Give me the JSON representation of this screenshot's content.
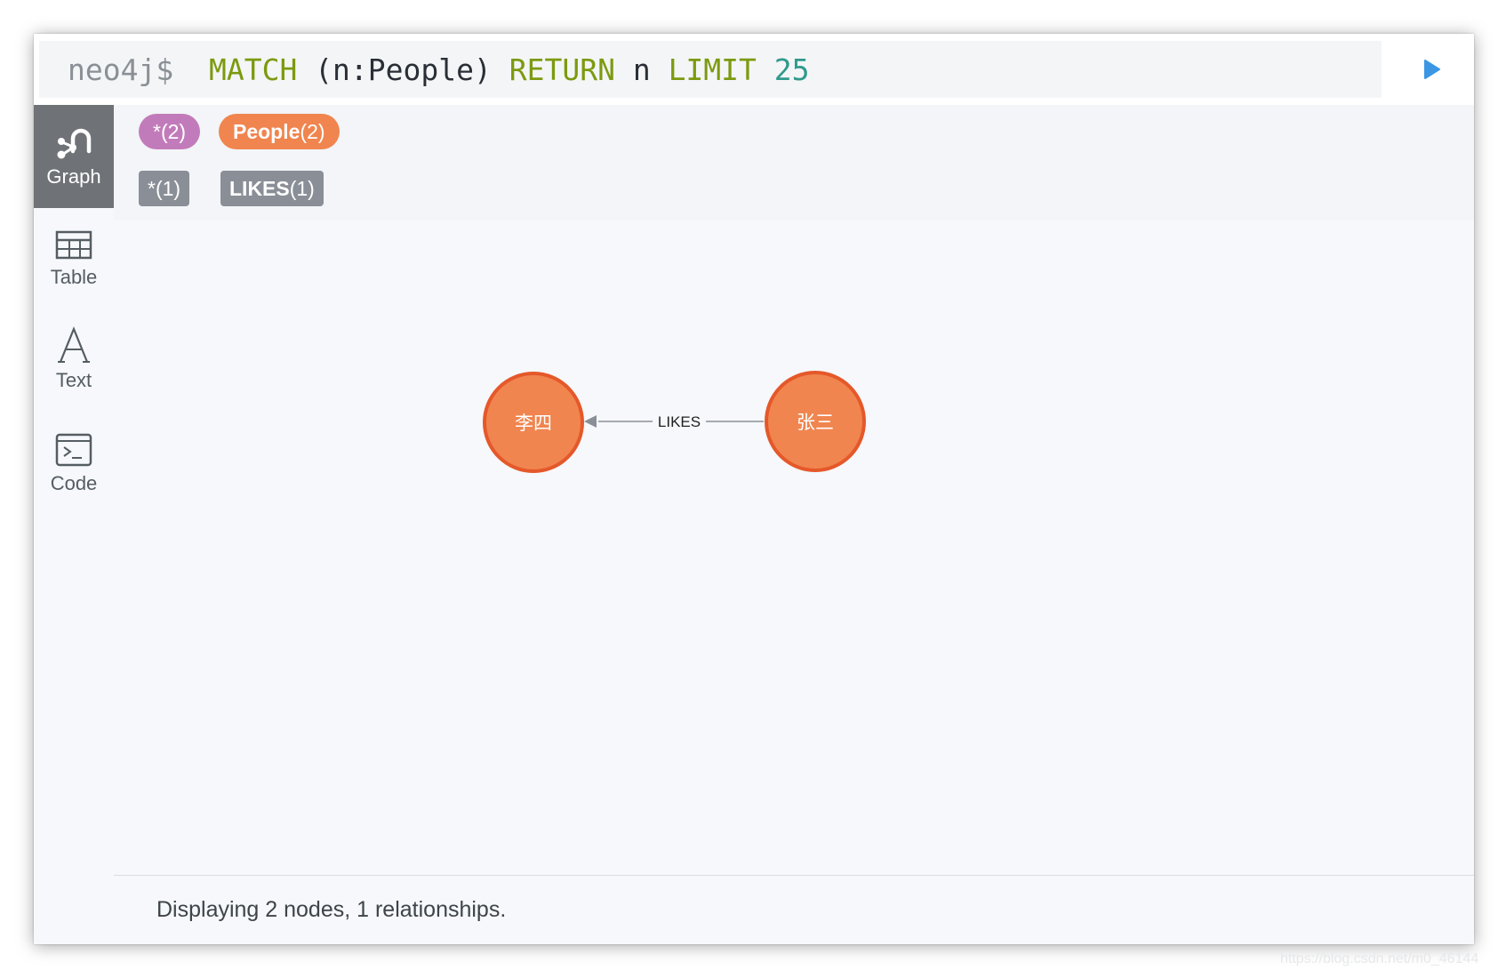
{
  "editor": {
    "prompt": "neo4j$",
    "tokens": [
      {
        "text": "MATCH",
        "kind": "keyword"
      },
      {
        "text": " (n:People) ",
        "kind": "plain"
      },
      {
        "text": "RETURN",
        "kind": "keyword"
      },
      {
        "text": " n ",
        "kind": "plain"
      },
      {
        "text": "LIMIT",
        "kind": "keyword"
      },
      {
        "text": " 25",
        "kind": "number"
      }
    ],
    "run_icon": "play-icon"
  },
  "sidebar": {
    "items": [
      {
        "label": "Graph",
        "icon": "graph-icon",
        "active": true
      },
      {
        "label": "Table",
        "icon": "table-icon",
        "active": false
      },
      {
        "label": "Text",
        "icon": "text-icon",
        "active": false
      },
      {
        "label": "Code",
        "icon": "code-icon",
        "active": false
      }
    ]
  },
  "legend": {
    "node_labels": [
      {
        "name": "*",
        "count": "(2)",
        "color": "#c27bba"
      },
      {
        "name": "People",
        "count": "(2)",
        "color": "#f0854f"
      }
    ],
    "relationship_types": [
      {
        "name": "*",
        "count": "(1)",
        "color": "#8a8f97"
      },
      {
        "name": "LIKES",
        "count": "(1)",
        "color": "#8a8f97"
      }
    ]
  },
  "graph": {
    "nodes": [
      {
        "caption": "李四",
        "color": "#f0854f",
        "border": "#e5582a"
      },
      {
        "caption": "张三",
        "color": "#f0854f",
        "border": "#e5582a"
      }
    ],
    "relationship": {
      "type": "LIKES",
      "color": "#8a8f97"
    }
  },
  "status": {
    "text": "Displaying 2 nodes, 1 relationships."
  },
  "watermark": "https://blog.csdn.net/m0_46144"
}
